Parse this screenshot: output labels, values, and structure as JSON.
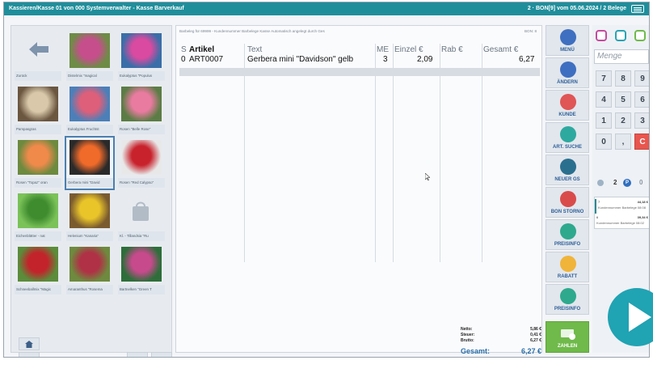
{
  "window": {
    "title": "Kassieren/Kasse 01 von 000 Systemverwalter - Kasse Barverkauf",
    "status_right": "2 · BON[9] vom 05.06.2024 / 2 Belege"
  },
  "tiles": [
    {
      "label": "Zurück",
      "kind": "back"
    },
    {
      "label": "Distelmix \"magical",
      "kind": "photo",
      "colors": [
        "#c64e8c",
        "#6e8c46"
      ]
    },
    {
      "label": "Eukalyptus \"Populus",
      "kind": "photo",
      "colors": [
        "#d94aa0",
        "#3a6ea8"
      ]
    },
    {
      "label": "Pampasgras",
      "kind": "photo",
      "colors": [
        "#d9c9aa",
        "#6b5640"
      ]
    },
    {
      "label": "Eukalyptus Fruchtst",
      "kind": "photo",
      "colors": [
        "#de5f7a",
        "#4c7fb8"
      ]
    },
    {
      "label": "Rosen \"Belle Rose\"",
      "kind": "photo",
      "colors": [
        "#e97ba0",
        "#5c7c45"
      ]
    },
    {
      "label": "Rosen \"Topaz\" oran",
      "kind": "photo",
      "colors": [
        "#f08a4b",
        "#6d8a3e"
      ]
    },
    {
      "label": "Gerbera mini \"David",
      "kind": "photo",
      "colors": [
        "#f06a2a",
        "#2a2a2a"
      ],
      "selected": true
    },
    {
      "label": "Rosen \"Red Calypso\"",
      "kind": "photo",
      "colors": [
        "#c8232d",
        "#e8e8e8"
      ]
    },
    {
      "label": "Eichenblätter - nat",
      "kind": "photo",
      "colors": [
        "#3f8c2f",
        "#7bc259"
      ]
    },
    {
      "label": "Helenium \"Kanaria\"",
      "kind": "photo",
      "colors": [
        "#e9c52a",
        "#7a5b2f"
      ]
    },
    {
      "label": "Kl. - Tillandsia \"Ru",
      "kind": "bag"
    },
    {
      "label": "Schneeballmix \"Magic",
      "kind": "photo",
      "colors": [
        "#c3232b",
        "#5b8c3a"
      ]
    },
    {
      "label": "Amaranthus \"Rosema",
      "kind": "photo",
      "colors": [
        "#b03046",
        "#6e8a3e"
      ]
    },
    {
      "label": "Bartnelken \"Green T",
      "kind": "photo",
      "colors": [
        "#c64a8c",
        "#2e6e3a"
      ]
    }
  ],
  "receipt": {
    "header": "Barbeleg für 69999 - Kundennummer Barbelege Kasse Automatisch angelegt durch Ges",
    "header_right": "BON: 8",
    "columns": {
      "s": "S",
      "artikel": "Artikel",
      "text": "Text",
      "me": "ME",
      "einzel": "Einzel €",
      "rab": "Rab €",
      "gesamt": "Gesamt €"
    },
    "rows": [
      {
        "s": "0",
        "artikel": "ART0007",
        "text": "Gerbera mini \"Davidson\" gelb",
        "me": "3",
        "einzel": "2,09",
        "rab": "",
        "gesamt": "6,27"
      }
    ],
    "totals": {
      "netto_label": "Netto:",
      "netto": "5,86 €",
      "steuer_label": "Steuer:",
      "steuer": "0,41 €",
      "brutto_label": "Brutto:",
      "brutto": "6,27 €",
      "gesamt_label": "Gesamt:",
      "gesamt": "6,27 €"
    }
  },
  "actions": [
    {
      "label": "MENÜ",
      "color": "#3f6fc0"
    },
    {
      "label": "ÄNDERN",
      "color": "#3f6fc0"
    },
    {
      "label": "KUNDE",
      "color": "#e05555"
    },
    {
      "label": "ART. SUCHE",
      "color": "#2ea9a0"
    },
    {
      "label": "NEUER GS",
      "color": "#2b6f8f"
    },
    {
      "label": "BON STORNO",
      "color": "#d94b4b"
    },
    {
      "label": "PREISINFO",
      "color": "#2ea98e"
    },
    {
      "label": "RABATT",
      "color": "#f0b43a"
    },
    {
      "label": "PREISINFO",
      "color": "#2ea98e"
    }
  ],
  "pay": {
    "label": "ZAHLEN"
  },
  "keypad": {
    "menge_placeholder": "Menge",
    "keys": [
      "7",
      "8",
      "9",
      "4",
      "5",
      "6",
      "1",
      "2",
      "3",
      "0",
      ",",
      "C"
    ],
    "counter_mid": "2",
    "counter_right": "0",
    "bons": [
      {
        "id": "7",
        "amount": "44,18 €",
        "sub": "Kundennummer Barbelege 08:08"
      },
      {
        "id": "6",
        "amount": "39,34 €",
        "sub": "Kundennummer Barbelege 08:02"
      }
    ]
  }
}
